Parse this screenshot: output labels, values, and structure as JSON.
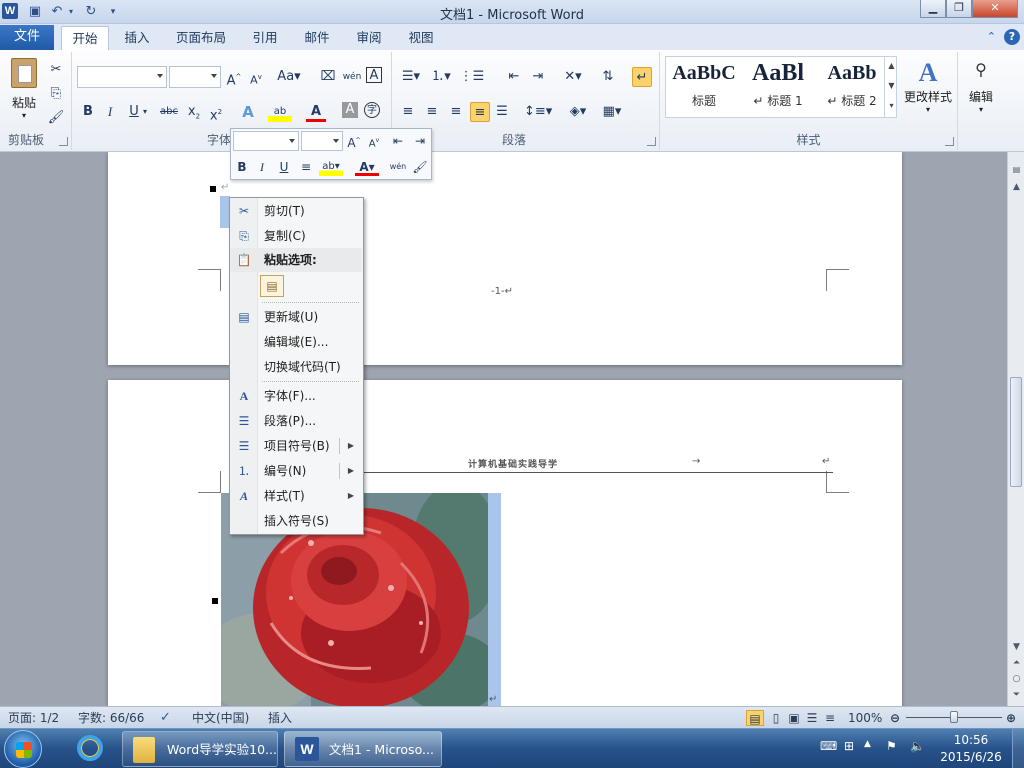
{
  "window": {
    "title": "文档1 - Microsoft Word",
    "logo": "W"
  },
  "tabs": {
    "file": "文件",
    "items": [
      "开始",
      "插入",
      "页面布局",
      "引用",
      "邮件",
      "审阅",
      "视图"
    ]
  },
  "ribbon": {
    "clipboard": {
      "label": "剪贴板",
      "paste": "粘贴"
    },
    "font": {
      "label": "字体"
    },
    "paragraph": {
      "label": "段落"
    },
    "styles": {
      "label": "样式",
      "items": [
        {
          "preview": "AaBbC",
          "name": "标题"
        },
        {
          "preview": "AaBl",
          "name": "↵ 标题 1"
        },
        {
          "preview": "AaBb",
          "name": "↵ 标题 2"
        }
      ],
      "change": "更改样式"
    },
    "editing": {
      "label": "编辑"
    }
  },
  "document": {
    "page_number": "-1-↵",
    "header_text": "计算机基础实践导学",
    "tab_arrow": "→",
    "return_mark": "↵"
  },
  "context_menu": {
    "items": [
      {
        "icon": "scissors-icon",
        "label": "剪切(T)"
      },
      {
        "icon": "copy-icon",
        "label": "复制(C)"
      },
      {
        "icon": "paste-icon",
        "label": "粘贴选项:"
      },
      {
        "icon": "update-field-icon",
        "label": "更新域(U)"
      },
      {
        "icon": "",
        "label": "编辑域(E)..."
      },
      {
        "icon": "",
        "label": "切换域代码(T)"
      },
      {
        "icon": "font-icon",
        "label": "字体(F)..."
      },
      {
        "icon": "paragraph-icon",
        "label": "段落(P)..."
      },
      {
        "icon": "bullets-icon",
        "label": "项目符号(B)"
      },
      {
        "icon": "numbering-icon",
        "label": "编号(N)"
      },
      {
        "icon": "styles-icon",
        "label": "样式(T)"
      },
      {
        "icon": "",
        "label": "插入符号(S)"
      }
    ]
  },
  "status": {
    "page": "页面: 1/2",
    "words": "字数: 66/66",
    "language": "中文(中国)",
    "mode": "插入",
    "zoom": "100%",
    "zoom_level": 0.5
  },
  "taskbar": {
    "items": [
      "Word导学实验10...",
      "文档1 - Microso..."
    ],
    "time": "10:56",
    "date": "2015/6/26"
  }
}
